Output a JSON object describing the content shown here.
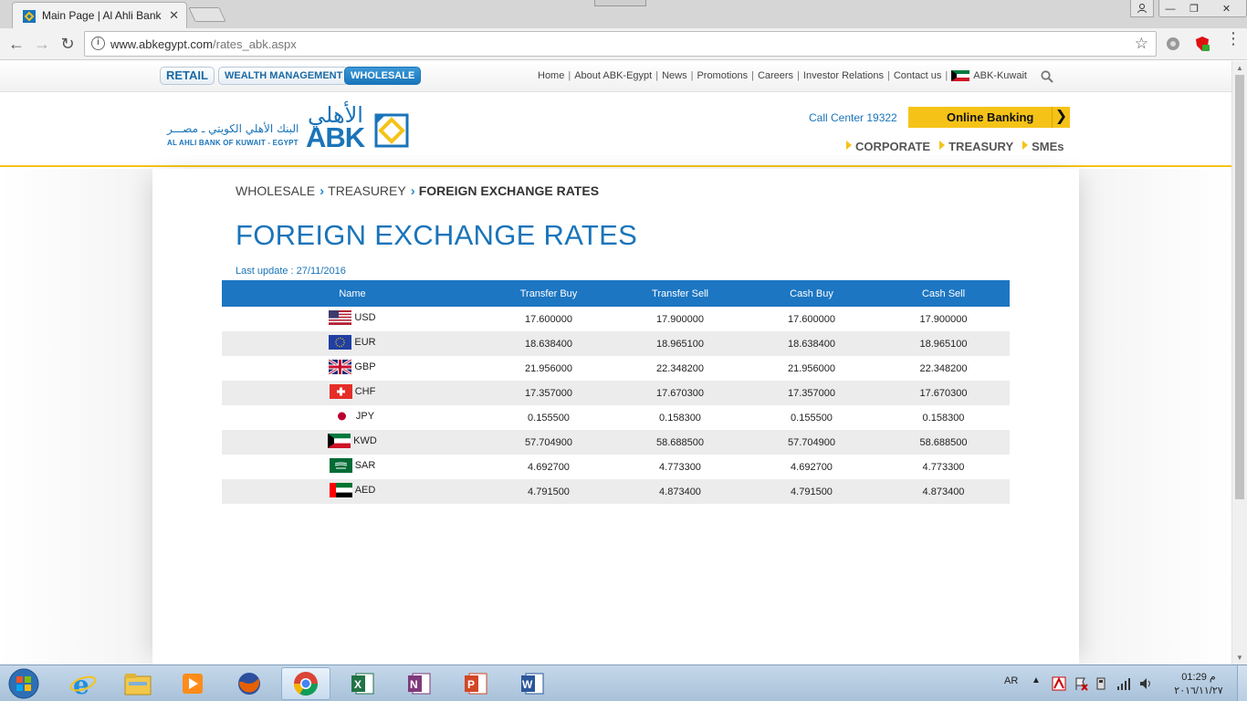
{
  "browser": {
    "tab_title": "Main Page | Al Ahli Bank",
    "tab_close": "✕",
    "url_host": "www.abkegypt.com",
    "url_path": "/rates_abk.aspx",
    "back": "←",
    "forward": "→",
    "reload": "↻",
    "star": "☆",
    "info": "i",
    "menu": "⋮",
    "win_min": "—",
    "win_max": "❐",
    "win_close": "✕"
  },
  "site": {
    "segments": [
      "RETAIL",
      "WEALTH MANAGEMENT",
      "WHOLESALE"
    ],
    "top_links": [
      "Home",
      "About ABK-Egypt",
      "News",
      "Promotions",
      "Careers",
      "Investor Relations",
      "Contact us"
    ],
    "kuwait_link": "ABK-Kuwait",
    "logo_arabic": "البنك الأهلي الكويتي ـ مصـــر",
    "logo_arabic_big": "الأهلي",
    "logo_english": "AL AHLI BANK OF KUWAIT - EGYPT",
    "logo_abk": "ABK",
    "call_center": "Call Center 19322",
    "online_banking": "Online Banking",
    "online_banking_arrow": "❯",
    "segment_nav": [
      "CORPORATE",
      "TREASURY",
      "SMEs"
    ],
    "accent_blue": "#1a74b9",
    "accent_yellow": "#f5c318"
  },
  "page": {
    "breadcrumb": [
      "WHOLESALE",
      "TREASUREY",
      "FOREIGN EXCHANGE RATES"
    ],
    "title": "FOREIGN EXCHANGE RATES",
    "last_update": "Last update : 27/11/2016",
    "table": {
      "headers": [
        "Name",
        "Transfer Buy",
        "Transfer Sell",
        "Cash Buy",
        "Cash Sell"
      ],
      "rows": [
        {
          "code": "USD",
          "flag": "us-flag",
          "transfer_buy": "17.600000",
          "transfer_sell": "17.900000",
          "cash_buy": "17.600000",
          "cash_sell": "17.900000"
        },
        {
          "code": "EUR",
          "flag": "eu-flag",
          "transfer_buy": "18.638400",
          "transfer_sell": "18.965100",
          "cash_buy": "18.638400",
          "cash_sell": "18.965100"
        },
        {
          "code": "GBP",
          "flag": "uk-flag",
          "transfer_buy": "21.956000",
          "transfer_sell": "22.348200",
          "cash_buy": "21.956000",
          "cash_sell": "22.348200"
        },
        {
          "code": "CHF",
          "flag": "ch-flag",
          "transfer_buy": "17.357000",
          "transfer_sell": "17.670300",
          "cash_buy": "17.357000",
          "cash_sell": "17.670300"
        },
        {
          "code": "JPY",
          "flag": "jp-flag",
          "transfer_buy": "0.155500",
          "transfer_sell": "0.158300",
          "cash_buy": "0.155500",
          "cash_sell": "0.158300"
        },
        {
          "code": "KWD",
          "flag": "kw-flag",
          "transfer_buy": "57.704900",
          "transfer_sell": "58.688500",
          "cash_buy": "57.704900",
          "cash_sell": "58.688500"
        },
        {
          "code": "SAR",
          "flag": "sa-flag",
          "transfer_buy": "4.692700",
          "transfer_sell": "4.773300",
          "cash_buy": "4.692700",
          "cash_sell": "4.773300"
        },
        {
          "code": "AED",
          "flag": "ae-flag",
          "transfer_buy": "4.791500",
          "transfer_sell": "4.873400",
          "cash_buy": "4.791500",
          "cash_sell": "4.873400"
        }
      ]
    }
  },
  "taskbar": {
    "apps": [
      "internet-explorer-icon",
      "file-explorer-icon",
      "media-player-icon",
      "firefox-icon",
      "chrome-icon",
      "excel-icon",
      "onenote-icon",
      "powerpoint-icon",
      "word-icon"
    ],
    "lang": "AR",
    "tray_up": "▲",
    "time": "01:29 م",
    "date": "٢٠١٦/١١/٢٧"
  }
}
